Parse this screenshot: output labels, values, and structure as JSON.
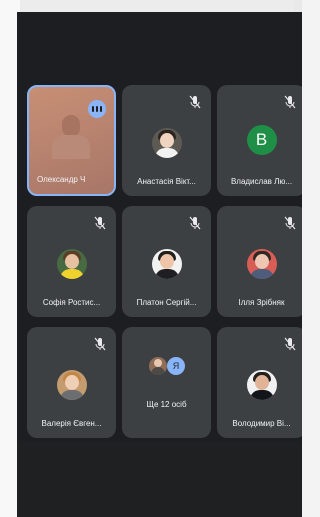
{
  "participants": [
    {
      "name": "Олександр Ч",
      "status": "speaking"
    },
    {
      "name": "Анастасія Вікт..."
    },
    {
      "name": "Владислав Лю...",
      "initial": "В",
      "avatar_color": "#1f8f47"
    },
    {
      "name": "Софія Ростис..."
    },
    {
      "name": "Платон Сергій..."
    },
    {
      "name": "Ілля Зрібняк"
    },
    {
      "name": "Валерія Євген..."
    },
    {
      "name": "Ще 12 осіб",
      "preview_initial": "Я"
    },
    {
      "name": "Володимир Ві..."
    }
  ],
  "icons": {
    "muted": "mic-off-icon",
    "speaking": "speaking-indicator-icon"
  },
  "colors": {
    "background": "#1d1e21",
    "tile": "#3c4043",
    "accent": "#8ab4f8"
  }
}
